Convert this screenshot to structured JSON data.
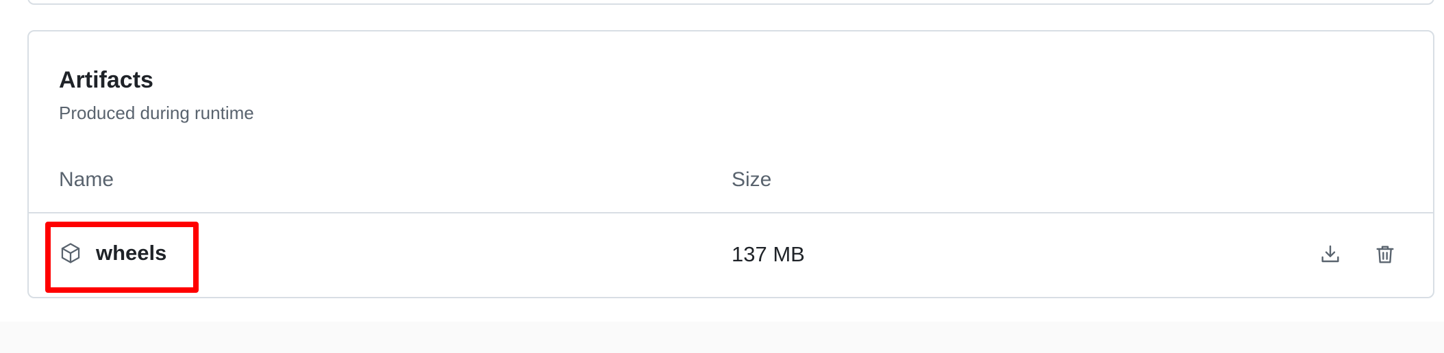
{
  "artifacts": {
    "title": "Artifacts",
    "subtitle": "Produced during runtime",
    "columns": {
      "name": "Name",
      "size": "Size"
    },
    "rows": [
      {
        "name": "wheels",
        "size": "137 MB",
        "icon": "package-icon",
        "actions": [
          "download-icon",
          "trash-icon"
        ]
      }
    ]
  },
  "colors": {
    "border": "#d8dee4",
    "muted_text": "#59636e",
    "text": "#1f2328",
    "highlight": "#ff0000"
  }
}
